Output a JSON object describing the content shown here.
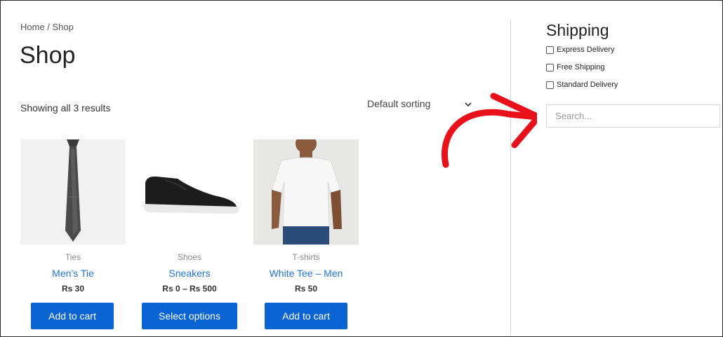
{
  "breadcrumb": "Home / Shop",
  "page_title": "Shop",
  "result_count": "Showing all 3 results",
  "sorting": {
    "selected": "Default sorting"
  },
  "products": [
    {
      "category": "Ties",
      "name": "Men’s Tie",
      "price": "Rs 30",
      "button": "Add to cart"
    },
    {
      "category": "Shoes",
      "name": "Sneakers",
      "price": "Rs 0 – Rs 500",
      "button": "Select options"
    },
    {
      "category": "T-shirts",
      "name": "White Tee – Men",
      "price": "Rs 50",
      "button": "Add to cart"
    }
  ],
  "sidebar": {
    "title": "Shipping",
    "filters": [
      "Express Delivery",
      "Free Shipping",
      "Standard Delivery"
    ],
    "search_placeholder": "Search..."
  },
  "colors": {
    "accent": "#0a64d4",
    "link": "#1e73d6",
    "arrow": "#e8101a"
  },
  "icons": [
    "chevron-down-icon",
    "arrow-annotation-icon"
  ]
}
